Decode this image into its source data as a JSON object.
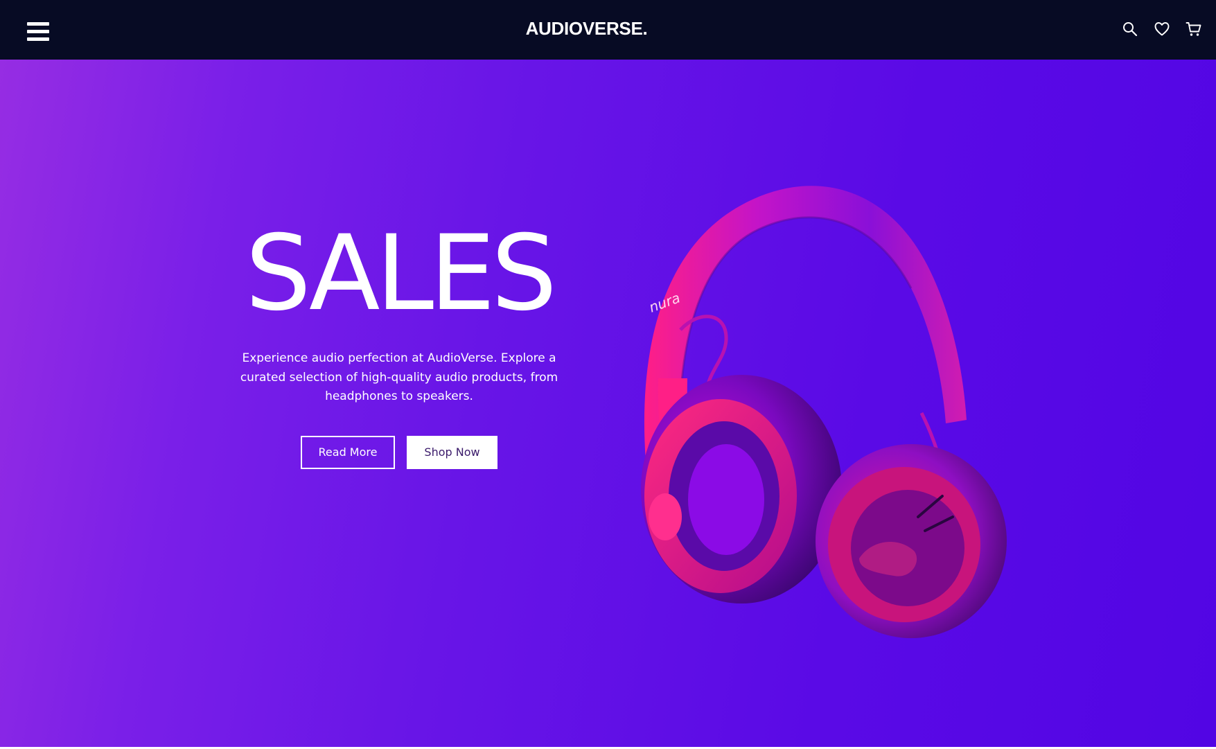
{
  "header": {
    "logo": "AUDIOVERSE.",
    "menu_icon": "hamburger-menu-icon",
    "icons": [
      "search-icon",
      "heart-icon",
      "cart-icon"
    ],
    "background": "#070b24"
  },
  "hero": {
    "title": "SALES",
    "description": "Experience audio perfection at AudioVerse. Explore a curated selection of high-quality audio products, from headphones to speakers.",
    "buttons": {
      "read_more": "Read More",
      "shop_now": "Shop Now"
    },
    "product_brand": "nura",
    "gradient_colors": [
      "#962de3",
      "#5205e4"
    ],
    "product_accent": "#ff1a8c"
  }
}
